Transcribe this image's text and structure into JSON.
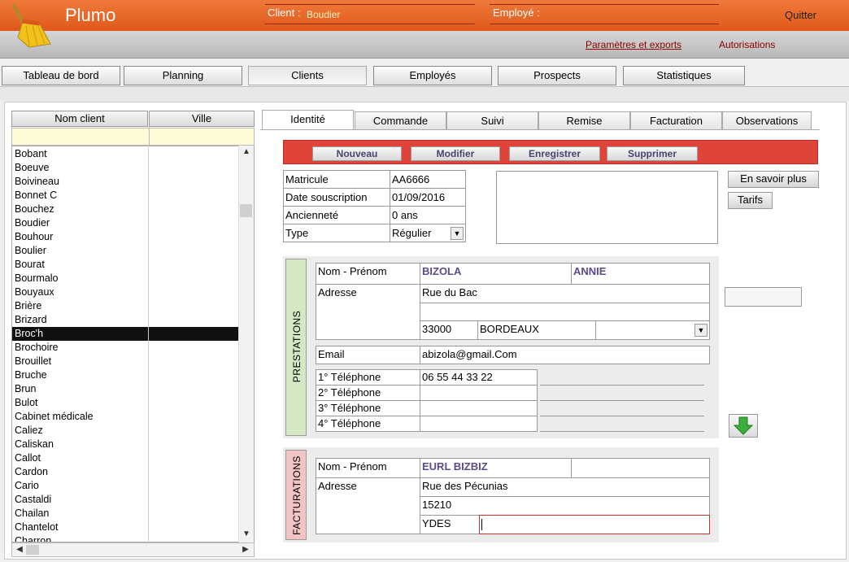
{
  "app": {
    "title": "Plumo",
    "logo_icon": "broom-icon"
  },
  "header": {
    "client_label": "Client :",
    "client_value": "Boudier",
    "employee_label": "Employé :",
    "employee_value": "",
    "quit_label": "Quitter"
  },
  "subheader": {
    "settings_link": "Paramètres et exports",
    "permissions_link": "Autorisations"
  },
  "nav": {
    "tabs": [
      "Tableau de bord",
      "Planning",
      "Clients",
      "Employés",
      "Prospects",
      "Statistiques"
    ],
    "active": "Clients"
  },
  "client_list": {
    "col_name": "Nom client",
    "col_city": "Ville",
    "items": [
      "Bobant",
      "Boeuve",
      "Boivineau",
      "Bonnet C",
      "Bouchez",
      "Boudier",
      "Bouhour",
      "Boulier",
      "Bourat",
      "Bourmalo",
      "Bouyaux",
      "Brière",
      "Brizard",
      "Broc'h",
      "Brochoire",
      "Brouillet",
      "Bruche",
      "Brun",
      "Bulot",
      "Cabinet médicale",
      "Caliez",
      "Caliskan",
      "Callot",
      "Cardon",
      "Cario",
      "Castaldi",
      "Chailan",
      "Chantelot",
      "Charron"
    ],
    "selected": "Broc'h"
  },
  "detail_tabs": [
    "Identité",
    "Commande",
    "Suivi",
    "Remise",
    "Facturation",
    "Observations"
  ],
  "toolbar": {
    "new": "Nouveau",
    "edit": "Modifier",
    "save": "Enregistrer",
    "delete": "Supprimer"
  },
  "identity": {
    "matricule_label": "Matricule",
    "matricule": "AA6666",
    "date_label": "Date souscription",
    "date": "01/09/2016",
    "seniority_label": "Ancienneté",
    "seniority": "0 ans",
    "type_label": "Type",
    "type": "Régulier"
  },
  "side_buttons": {
    "more": "En savoir plus",
    "rates": "Tarifs"
  },
  "prestations": {
    "section_label": "PRESTATIONS",
    "name_label": "Nom - Prénom",
    "last_name": "BIZOLA",
    "first_name": "ANNIE",
    "address_label": "Adresse",
    "address1": "Rue du Bac",
    "address2": "",
    "zip": "33000",
    "city": "BORDEAUX",
    "email_label": "Email",
    "email": "abizola@gmail.Com",
    "phone1_label": "1° Téléphone",
    "phone1": "06 55 44 33 22",
    "phone2_label": "2° Téléphone",
    "phone2": "",
    "phone3_label": "3° Téléphone",
    "phone3": "",
    "phone4_label": "4° Téléphone",
    "phone4": ""
  },
  "facturations": {
    "section_label": "FACTURATIONS",
    "name_label": "Nom - Prénom",
    "name": "EURL BIZBIZ",
    "address_label": "Adresse",
    "address1": "Rue des Pécunias",
    "zip": "15210",
    "city": "YDES"
  },
  "colors": {
    "header_orange": "#e8652a",
    "toolbar_red": "#e04438",
    "prestations_green": "#d4e8c4",
    "facturations_pink": "#f2c4c4"
  }
}
